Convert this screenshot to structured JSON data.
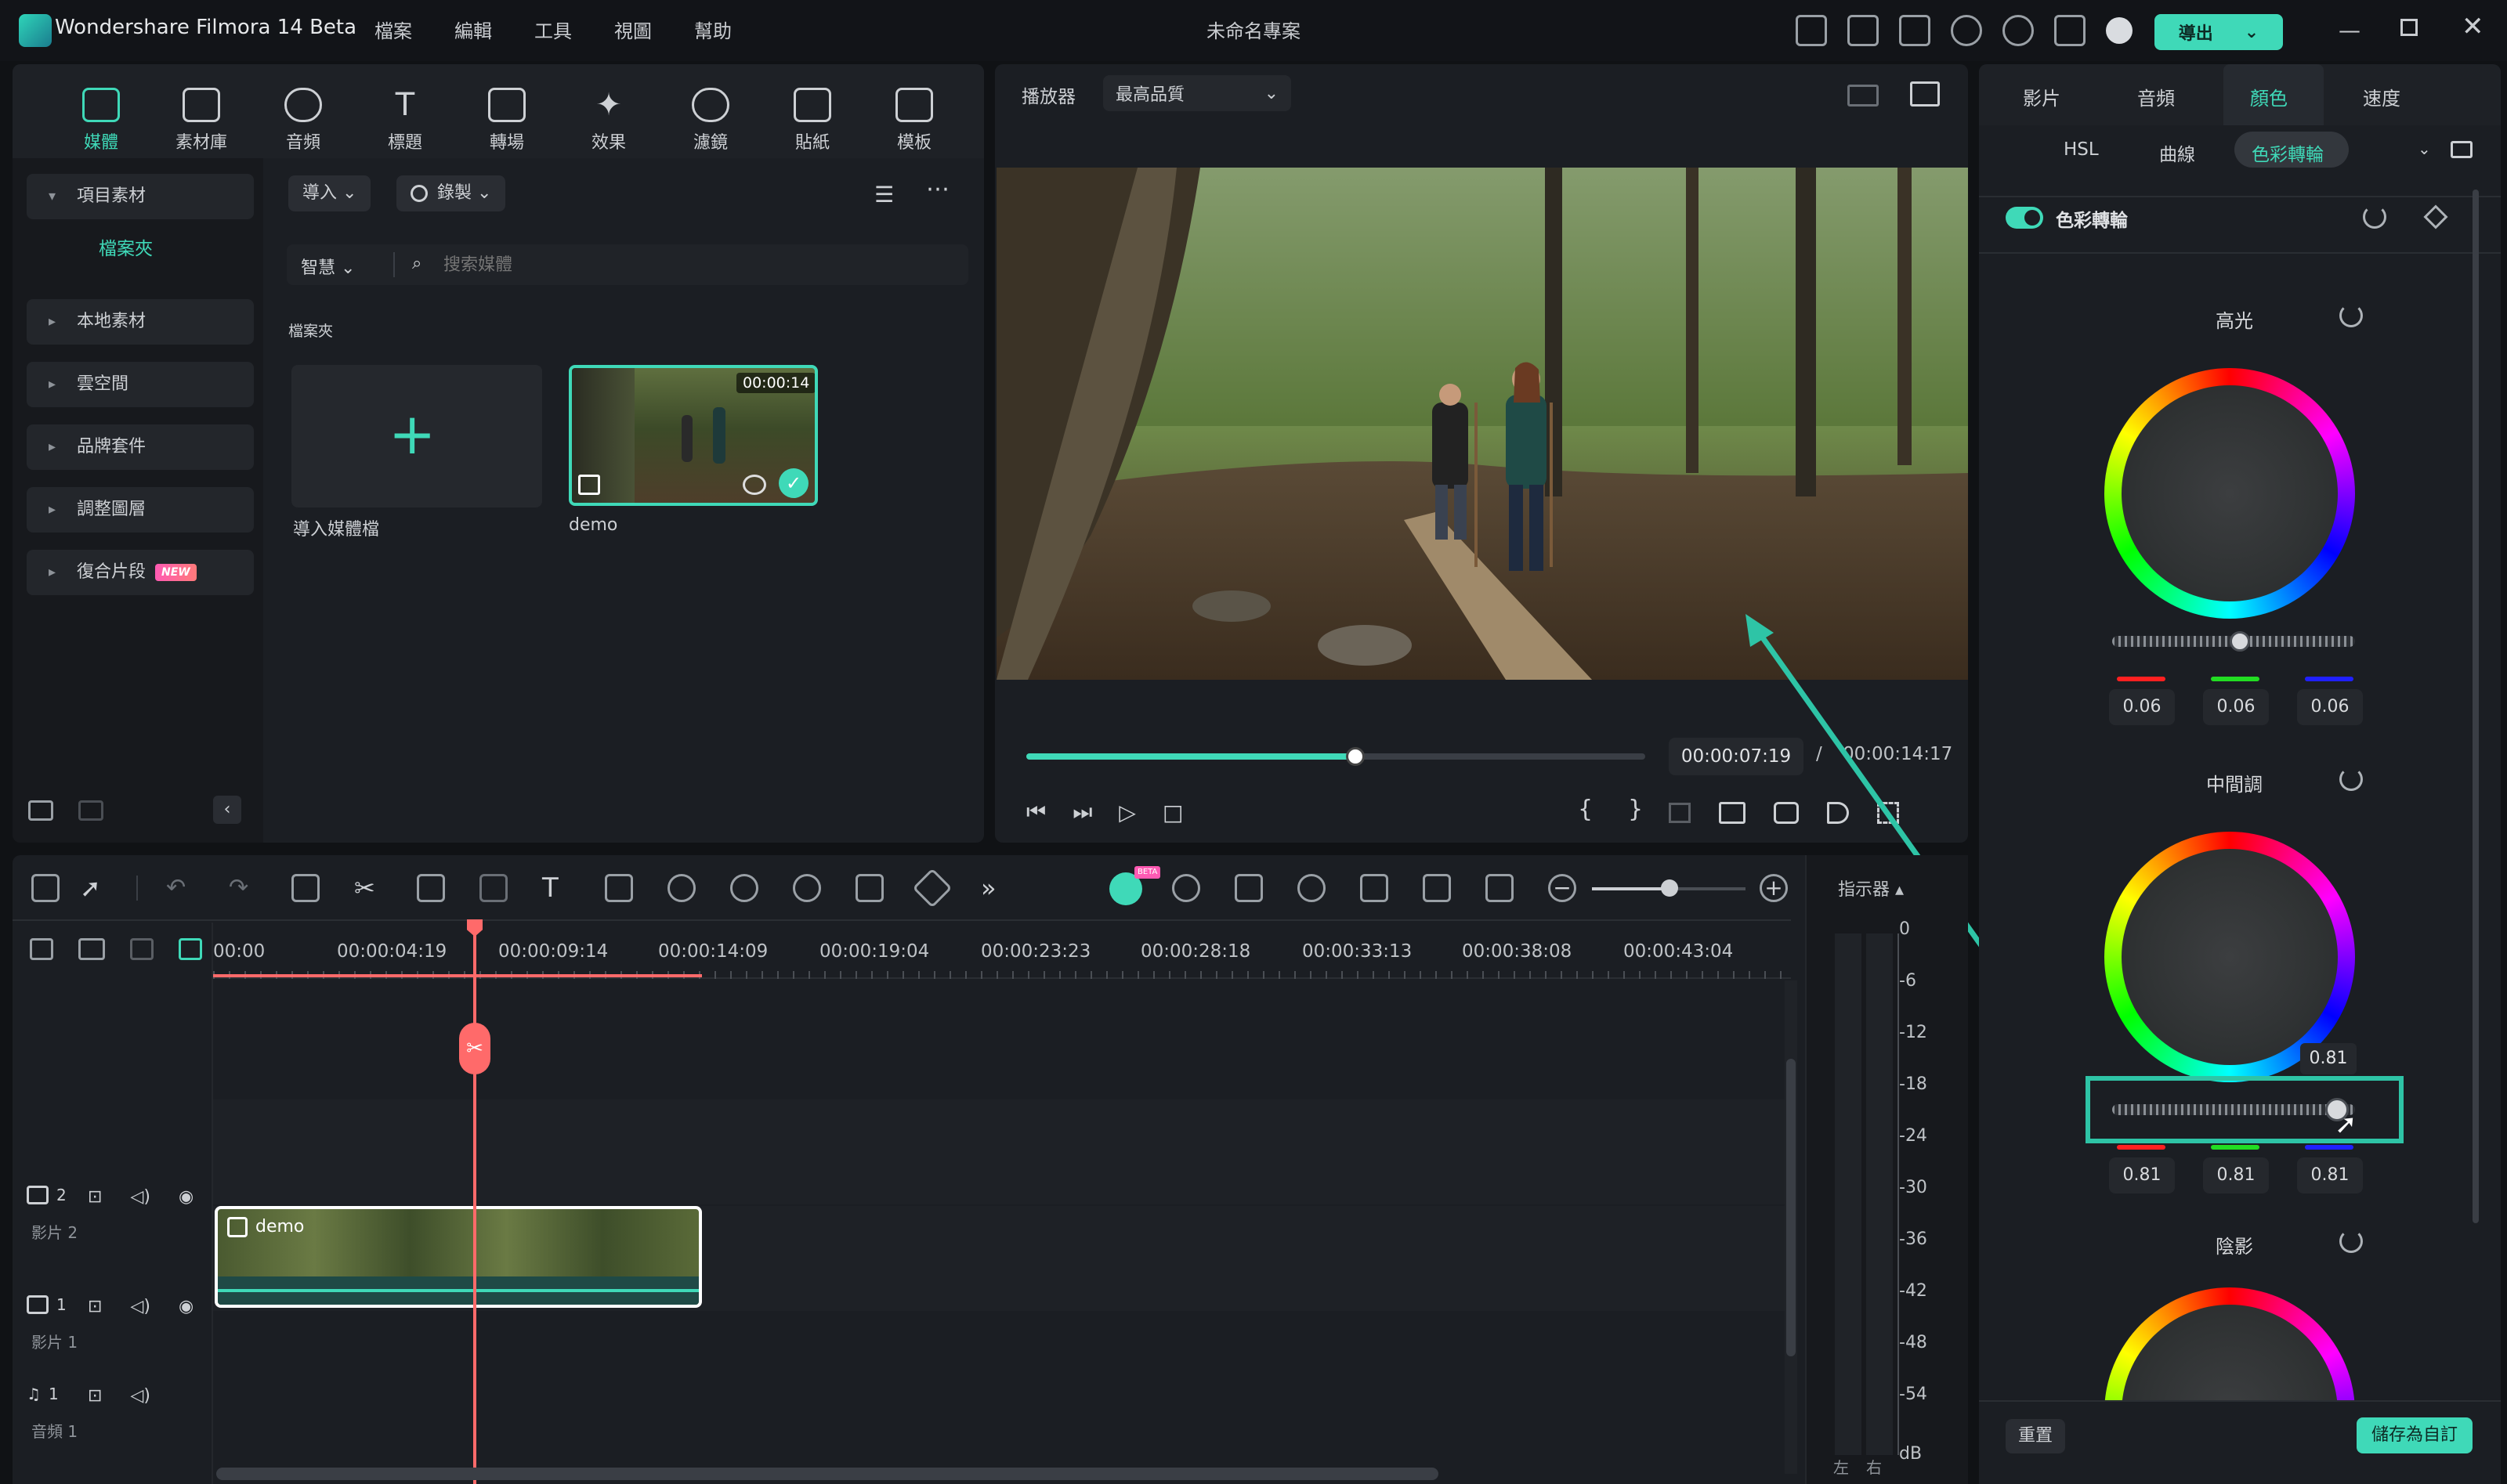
{
  "app": {
    "title": "Wondershare Filmora 14 Beta",
    "menu": [
      "檔案",
      "編輯",
      "工具",
      "視圖",
      "幫助"
    ],
    "project_name": "未命名專案",
    "export_label": "導出",
    "accent": "#3fd9b8"
  },
  "media_tabs": [
    {
      "label": "媒體",
      "icon": "media-icon",
      "active": true
    },
    {
      "label": "素材庫",
      "icon": "stock-library-icon"
    },
    {
      "label": "音頻",
      "icon": "music-note-icon"
    },
    {
      "label": "標題",
      "icon": "title-t-icon"
    },
    {
      "label": "轉場",
      "icon": "transition-icon"
    },
    {
      "label": "效果",
      "icon": "effects-star-icon"
    },
    {
      "label": "濾鏡",
      "icon": "filters-icon"
    },
    {
      "label": "貼紙",
      "icon": "sticker-icon"
    },
    {
      "label": "模板",
      "icon": "template-icon"
    }
  ],
  "media_sidebar": {
    "project_media": "項目素材",
    "folder": "檔案夾",
    "items": [
      "本地素材",
      "雲空間",
      "品牌套件",
      "調整圖層",
      "復合片段"
    ],
    "new_badge": "NEW"
  },
  "media_toolbar": {
    "import_label": "導入",
    "record_label": "錄製",
    "smart_label": "智慧",
    "search_placeholder": "搜索媒體",
    "section_title": "檔案夾"
  },
  "media_items": [
    {
      "name": "導入媒體檔",
      "type": "import"
    },
    {
      "name": "demo",
      "duration": "00:00:14",
      "selected": true
    }
  ],
  "player": {
    "label": "播放器",
    "quality": "最高品質",
    "current_time": "00:00:07:19",
    "separator": "/",
    "total_time": "00:00:14:17",
    "progress_fraction": 0.53,
    "brace_open": "{",
    "brace_close": "}"
  },
  "properties": {
    "tabs": [
      "影片",
      "音頻",
      "顏色",
      "速度"
    ],
    "active_tab": "顏色",
    "subtabs": [
      "HSL",
      "曲線",
      "色彩轉輪"
    ],
    "active_subtab": "色彩轉輪",
    "toggle_label": "色彩轉輪",
    "sections": [
      {
        "title": "高光",
        "values": [
          "0.06",
          "0.06",
          "0.06"
        ],
        "slider_fraction": 0.5
      },
      {
        "title": "中間調",
        "values": [
          "0.81",
          "0.81",
          "0.81"
        ],
        "tooltip": "0.81",
        "slider_fraction": 0.9
      },
      {
        "title": "陰影"
      }
    ],
    "reset_label": "重置",
    "save_label": "儲存為自訂"
  },
  "timeline": {
    "ruler": [
      "00:00",
      "00:00:04:19",
      "00:00:09:14",
      "00:00:14:09",
      "00:00:19:04",
      "00:00:23:23",
      "00:00:28:18",
      "00:00:33:13",
      "00:00:38:08",
      "00:00:43:04"
    ],
    "tracks": [
      {
        "id": "2",
        "name": "影片 2"
      },
      {
        "id": "1",
        "name": "影片 1"
      },
      {
        "id": "1",
        "name": "音頻 1"
      }
    ],
    "clip_name": "demo",
    "meter_title": "指示器",
    "meter_scale": [
      "0",
      "-6",
      "-12",
      "-18",
      "-24",
      "-30",
      "-36",
      "-42",
      "-48",
      "-54",
      "dB"
    ],
    "meter_channels": [
      "左",
      "右"
    ],
    "beta_badge": "BETA"
  }
}
